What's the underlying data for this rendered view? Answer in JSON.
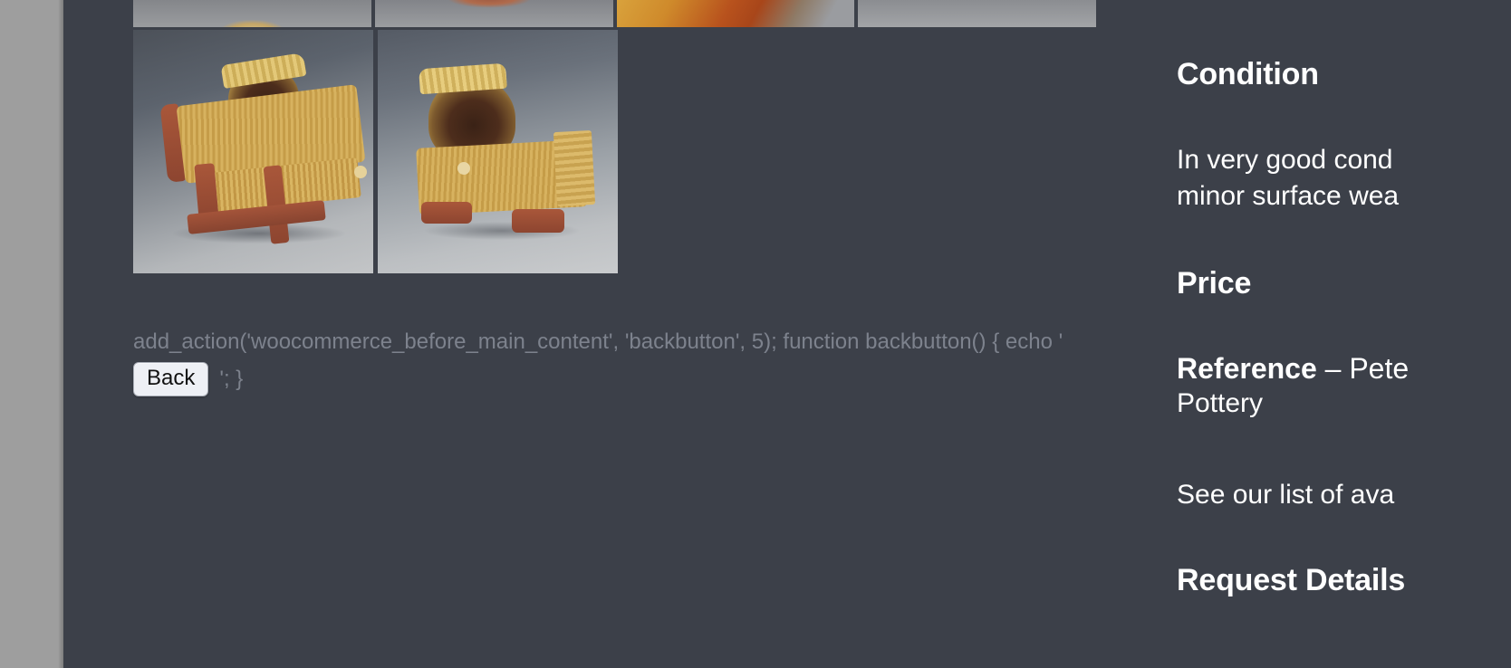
{
  "window": {
    "background_gray": "#9e9e9e",
    "page_background": "#3c4049",
    "text_color": "#ffffff",
    "muted_text_color": "#7d828d"
  },
  "gallery": {
    "name": "product-image-gallery",
    "thumbnails": [
      {
        "id": "thumb-1",
        "alt": "ceramic cradle top view"
      },
      {
        "id": "thumb-2",
        "alt": "ceramic cradle rim detail"
      },
      {
        "id": "thumb-3",
        "alt": "ceramic glaze detail orange and yellow"
      },
      {
        "id": "thumb-4",
        "alt": "ceramic cradle plain background"
      }
    ],
    "main_images": [
      {
        "id": "main-image-1",
        "alt": "Studio pottery cradle, three-quarter side view"
      },
      {
        "id": "main-image-2",
        "alt": "Studio pottery cradle, front hood view"
      }
    ]
  },
  "leaked_code": {
    "line1": "add_action('woocommerce_before_main_content', 'backbutton', 5); function backbutton() { echo '",
    "tail": "'; }"
  },
  "back_button": {
    "label": "Back"
  },
  "info": {
    "condition_heading": "Condition",
    "condition_text_line1": "In very good cond",
    "condition_text_line2": "minor surface wea",
    "price_heading": "Price",
    "reference_label": "Reference",
    "reference_rest": " – Pete",
    "reference_line2": "Pottery",
    "see_list_text": "See our list of ava",
    "request_heading": "Request Details"
  }
}
